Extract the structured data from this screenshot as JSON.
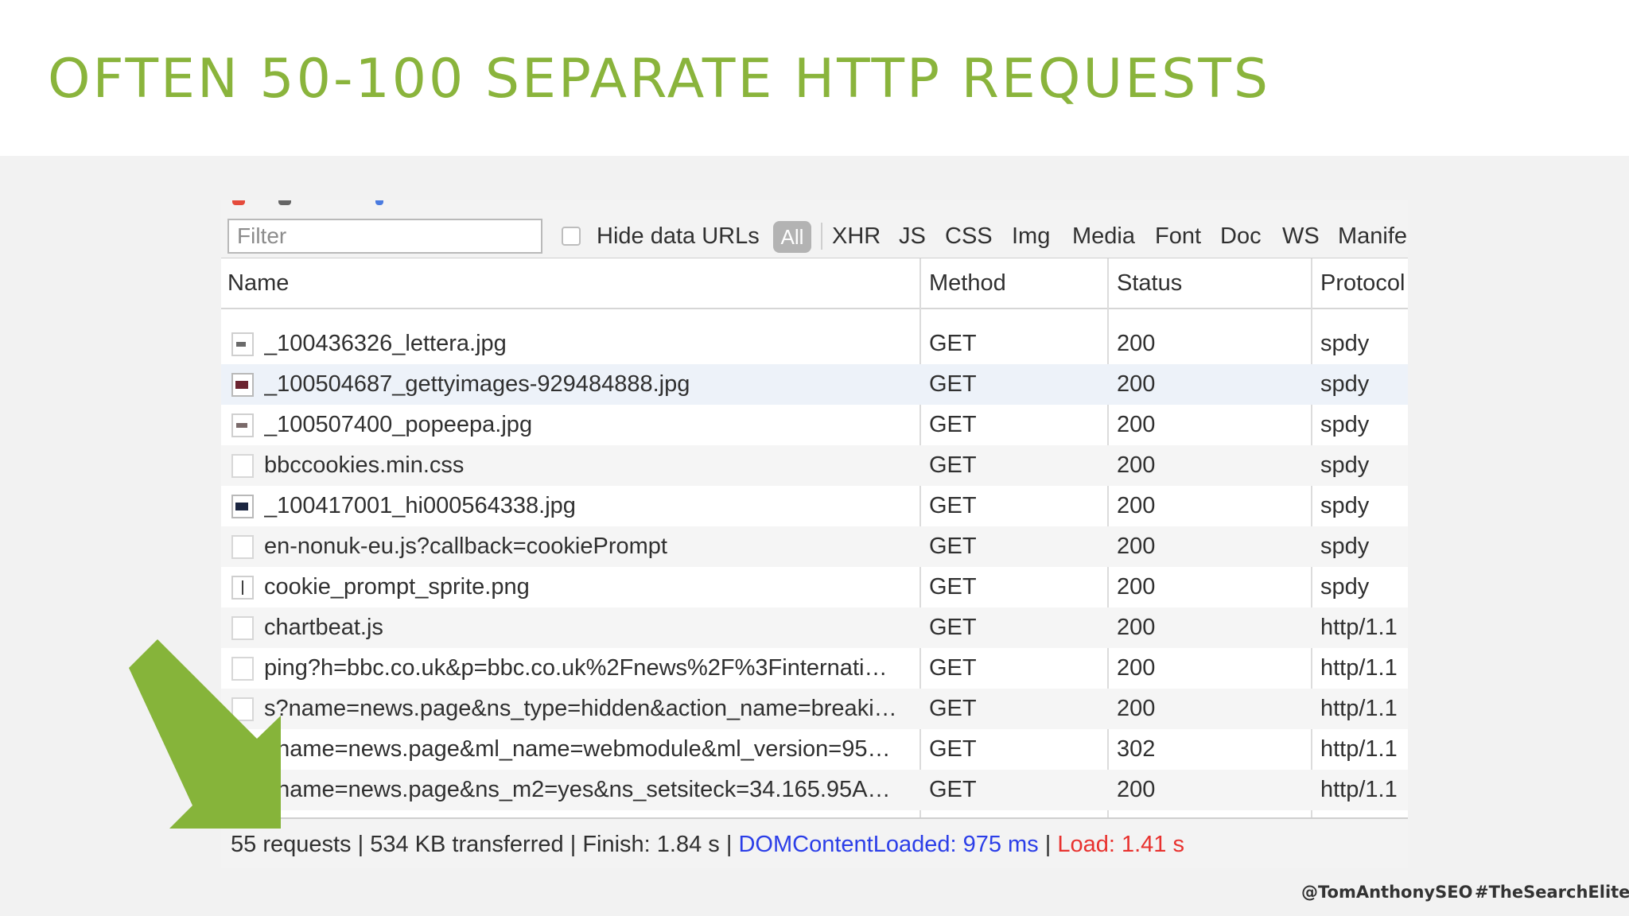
{
  "slide": {
    "title": "OFTEN 50-100 SEPARATE HTTP REQUESTS",
    "footer": {
      "handle": "@TomAnthonySEO",
      "hashtag": "#TheSearchElite"
    }
  },
  "colors": {
    "title": "#8ab43c",
    "arrow": "#86b43a",
    "dom_loaded": "#2b3ee8",
    "load": "#e8312e"
  },
  "devtools": {
    "filter": {
      "placeholder": "Filter",
      "value": ""
    },
    "hide_data_urls": {
      "label": "Hide data URLs",
      "checked": false
    },
    "type_filters": [
      "All",
      "XHR",
      "JS",
      "CSS",
      "Img",
      "Media",
      "Font",
      "Doc",
      "WS",
      "Manife"
    ],
    "active_type": "All",
    "columns": [
      "Name",
      "Method",
      "Status",
      "Protocol"
    ],
    "rows": [
      {
        "name": "_100436326_lettera.jpg",
        "method": "GET",
        "status": "200",
        "protocol": "spdy",
        "icon": "image-thumbnail-icon"
      },
      {
        "name": "_100504687_gettyimages-929484888.jpg",
        "method": "GET",
        "status": "200",
        "protocol": "spdy",
        "icon": "image-thumbnail-icon"
      },
      {
        "name": "_100507400_popeepa.jpg",
        "method": "GET",
        "status": "200",
        "protocol": "spdy",
        "icon": "image-thumbnail-icon"
      },
      {
        "name": "bbccookies.min.css",
        "method": "GET",
        "status": "200",
        "protocol": "spdy",
        "icon": "stylesheet-file-icon"
      },
      {
        "name": "_100417001_hi000564338.jpg",
        "method": "GET",
        "status": "200",
        "protocol": "spdy",
        "icon": "image-thumbnail-icon"
      },
      {
        "name": "en-nonuk-eu.js?callback=cookiePrompt",
        "method": "GET",
        "status": "200",
        "protocol": "spdy",
        "icon": "script-file-icon"
      },
      {
        "name": "cookie_prompt_sprite.png",
        "method": "GET",
        "status": "200",
        "protocol": "spdy",
        "icon": "image-thumbnail-icon"
      },
      {
        "name": "chartbeat.js",
        "method": "GET",
        "status": "200",
        "protocol": "http/1.1",
        "icon": "script-file-icon"
      },
      {
        "name": "ping?h=bbc.co.uk&p=bbc.co.uk%2Fnews%2F%3Finternati…",
        "method": "GET",
        "status": "200",
        "protocol": "http/1.1",
        "icon": "document-file-icon"
      },
      {
        "name": "s?name=news.page&ns_type=hidden&action_name=breaki…",
        "method": "GET",
        "status": "200",
        "protocol": "http/1.1",
        "icon": "document-file-icon"
      },
      {
        "name": "?name=news.page&ml_name=webmodule&ml_version=95…",
        "method": "GET",
        "status": "302",
        "protocol": "http/1.1",
        "icon": "document-file-icon"
      },
      {
        "name": "?name=news.page&ns_m2=yes&ns_setsiteck=34.165.95A…",
        "method": "GET",
        "status": "200",
        "protocol": "http/1.1",
        "icon": "document-file-icon"
      }
    ],
    "summary": {
      "requests": "55 requests",
      "transferred": "534 KB transferred",
      "finish": "Finish: 1.84 s",
      "dom_content_loaded": "DOMContentLoaded: 975 ms",
      "load": "Load: 1.41 s",
      "separator": "|"
    }
  }
}
